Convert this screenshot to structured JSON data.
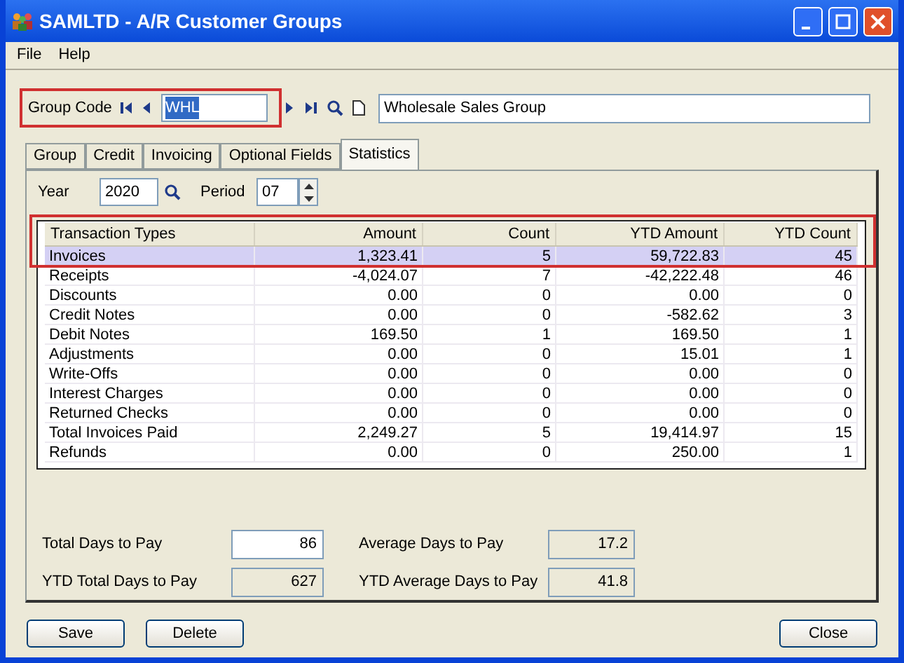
{
  "window": {
    "title": "SAMLTD - A/R Customer Groups"
  },
  "menu": [
    "File",
    "Help"
  ],
  "group_code": {
    "label": "Group Code",
    "value": "WHL",
    "highlighted": true,
    "description": "Wholesale Sales Group"
  },
  "tabs": [
    {
      "label": "Group",
      "selected": false
    },
    {
      "label": "Credit",
      "selected": false
    },
    {
      "label": "Invoicing",
      "selected": false
    },
    {
      "label": "Optional Fields",
      "selected": false
    },
    {
      "label": "Statistics",
      "selected": true
    }
  ],
  "year": {
    "label": "Year",
    "value": "2020"
  },
  "period": {
    "label": "Period",
    "value": "07"
  },
  "table": {
    "highlighted": true,
    "columns": [
      "Transaction Types",
      "Amount",
      "Count",
      "YTD Amount",
      "YTD Count"
    ],
    "rows": [
      {
        "cells": [
          "Invoices",
          "1,323.41",
          "5",
          "59,722.83",
          "45"
        ],
        "selected": true
      },
      {
        "cells": [
          "Receipts",
          "-4,024.07",
          "7",
          "-42,222.48",
          "46"
        ],
        "selected": false
      },
      {
        "cells": [
          "Discounts",
          "0.00",
          "0",
          "0.00",
          "0"
        ],
        "selected": false
      },
      {
        "cells": [
          "Credit Notes",
          "0.00",
          "0",
          "-582.62",
          "3"
        ],
        "selected": false
      },
      {
        "cells": [
          "Debit Notes",
          "169.50",
          "1",
          "169.50",
          "1"
        ],
        "selected": false
      },
      {
        "cells": [
          "Adjustments",
          "0.00",
          "0",
          "15.01",
          "1"
        ],
        "selected": false
      },
      {
        "cells": [
          "Write-Offs",
          "0.00",
          "0",
          "0.00",
          "0"
        ],
        "selected": false
      },
      {
        "cells": [
          "Interest Charges",
          "0.00",
          "0",
          "0.00",
          "0"
        ],
        "selected": false
      },
      {
        "cells": [
          "Returned Checks",
          "0.00",
          "0",
          "0.00",
          "0"
        ],
        "selected": false
      },
      {
        "cells": [
          "Total Invoices Paid",
          "2,249.27",
          "5",
          "19,414.97",
          "15"
        ],
        "selected": false
      },
      {
        "cells": [
          "Refunds",
          "0.00",
          "0",
          "250.00",
          "1"
        ],
        "selected": false
      }
    ]
  },
  "totals": [
    {
      "label": "Total Days to Pay",
      "value": "86",
      "disabled": false
    },
    {
      "label": "Average Days to Pay",
      "value": "17.2",
      "disabled": true
    },
    {
      "label": "YTD Total Days to Pay",
      "value": "627",
      "disabled": true
    },
    {
      "label": "YTD Average Days to Pay",
      "value": "41.8",
      "disabled": true
    }
  ],
  "buttons": [
    "Save",
    "Delete",
    "Close"
  ]
}
